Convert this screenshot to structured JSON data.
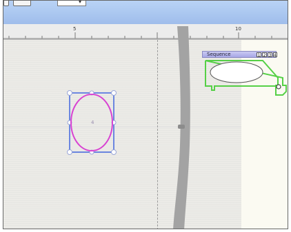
{
  "ruler": {
    "mark_left": "5",
    "mark_right": "10"
  },
  "shape": {
    "label": "4"
  },
  "palette": {
    "title": "Sequence",
    "buttons": [
      "1",
      "2",
      "3",
      "4"
    ]
  },
  "colors": {
    "toolbar": "#a8c4ef",
    "selection": "#6b86e0",
    "ellipse": "#d843d2",
    "palette_outline": "#55d046",
    "scrollbar": "#a3a3a3"
  }
}
